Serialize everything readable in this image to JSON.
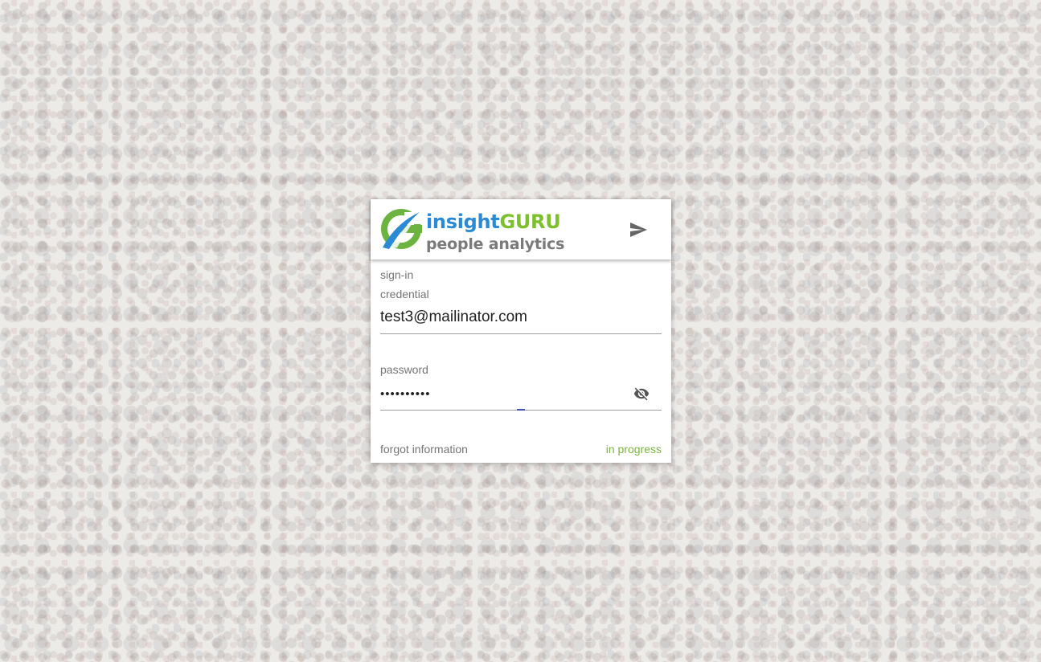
{
  "brand": {
    "name_part1": "insight",
    "name_part2": "GURU",
    "tagline": "people analytics",
    "colors": {
      "blue": "#2a8ad6",
      "green": "#7cc12b",
      "gray": "#7a7a7a"
    }
  },
  "header": {
    "submit_icon": "send-icon"
  },
  "form": {
    "section_label": "sign-in",
    "credential": {
      "label": "credential",
      "value": "test3@mailinator.com"
    },
    "password": {
      "label": "password",
      "value": "••••••••••",
      "toggle_icon": "visibility-off-icon"
    },
    "forgot_link": "forgot information",
    "status": "in progress",
    "status_color": "#7cb342"
  }
}
